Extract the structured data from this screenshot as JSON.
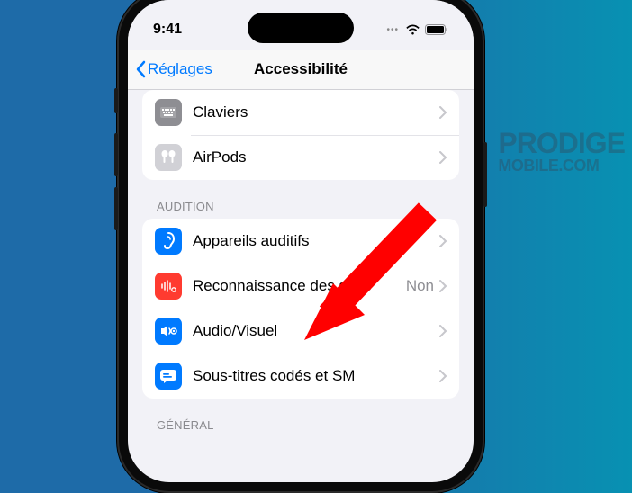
{
  "status": {
    "time": "9:41"
  },
  "nav": {
    "back": "Réglages",
    "title": "Accessibilité"
  },
  "group_top": {
    "rows": [
      {
        "label": "Claviers",
        "icon": "keyboard"
      },
      {
        "label": "AirPods",
        "icon": "airpods"
      }
    ]
  },
  "audition": {
    "header": "AUDITION",
    "rows": [
      {
        "label": "Appareils auditifs",
        "icon": "ear"
      },
      {
        "label": "Reconnaissance des sons",
        "icon": "waveform",
        "value": "Non"
      },
      {
        "label": "Audio/Visuel",
        "icon": "audiovisual"
      },
      {
        "label": "Sous-titres codés et SM",
        "icon": "captions"
      }
    ]
  },
  "general": {
    "header": "GÉNÉRAL"
  },
  "watermark": {
    "line1": "PRODIGE",
    "line2": "MOBILE.COM"
  }
}
